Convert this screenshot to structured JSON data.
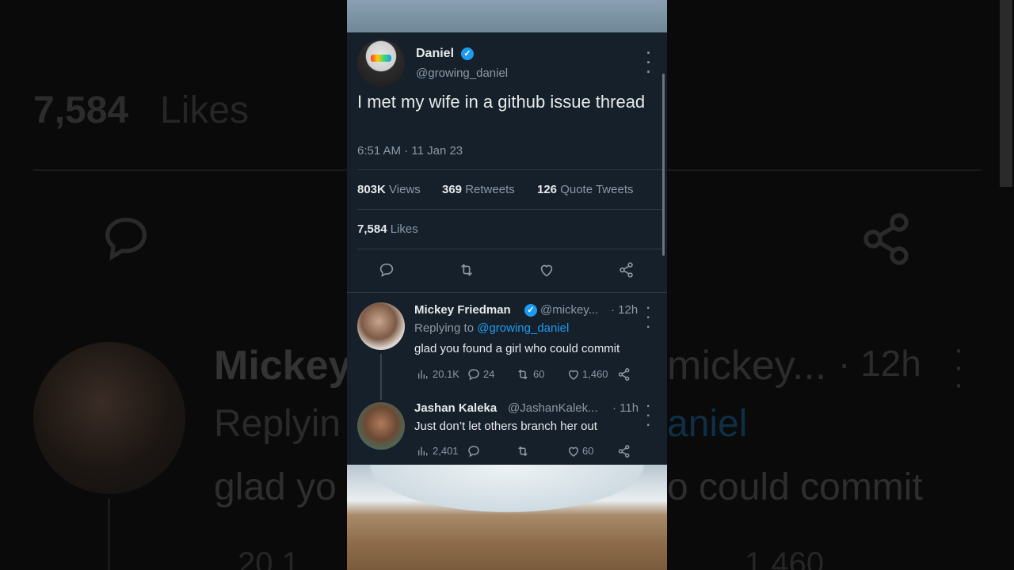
{
  "background": {
    "likes_count": "7,584",
    "likes_label": "Likes",
    "reply_name": "Mickey",
    "reply_handle": "mickey...",
    "reply_time": "· 12h",
    "reply_prefix": "Replyin",
    "reply_link": "aniel",
    "reply_text_left": "glad yo",
    "reply_text_right": "o could commit",
    "views_partial": "20.1",
    "likes_partial": "1,460"
  },
  "tweet": {
    "author_name": "Daniel",
    "author_handle": "@growing_daniel",
    "text": "I met my wife in a github issue thread",
    "timestamp": "6:51 AM · 11 Jan 23",
    "views_count": "803K",
    "views_label": "Views",
    "retweets_count": "369",
    "retweets_label": "Retweets",
    "quotes_count": "126",
    "quotes_label": "Quote Tweets",
    "likes_count": "7,584",
    "likes_label": "Likes"
  },
  "replies": [
    {
      "name": "Mickey Friedman",
      "handle": "@mickey...",
      "time": "· 12h",
      "replying_prefix": "Replying to",
      "replying_handle": "@growing_daniel",
      "text": "glad you found a girl who could commit",
      "views": "20.1K",
      "comments": "24",
      "retweets": "60",
      "likes": "1,460"
    },
    {
      "name": "Jashan Kaleka",
      "handle": "@JashanKalek...",
      "time": "· 11h",
      "text": "Just don’t let others branch her out",
      "views": "2,401",
      "comments": "",
      "retweets": "",
      "likes": "60"
    }
  ],
  "colors": {
    "background": "#15202b",
    "text": "#e7e9ea",
    "muted": "#8b98a5",
    "accent": "#1d9bf0",
    "divider": "#2f3942"
  },
  "icons": {
    "verified": "verified-badge-icon",
    "more": "more-options-icon",
    "reply": "reply-icon",
    "retweet": "retweet-icon",
    "like": "like-icon",
    "share": "share-icon",
    "views": "views-icon"
  }
}
